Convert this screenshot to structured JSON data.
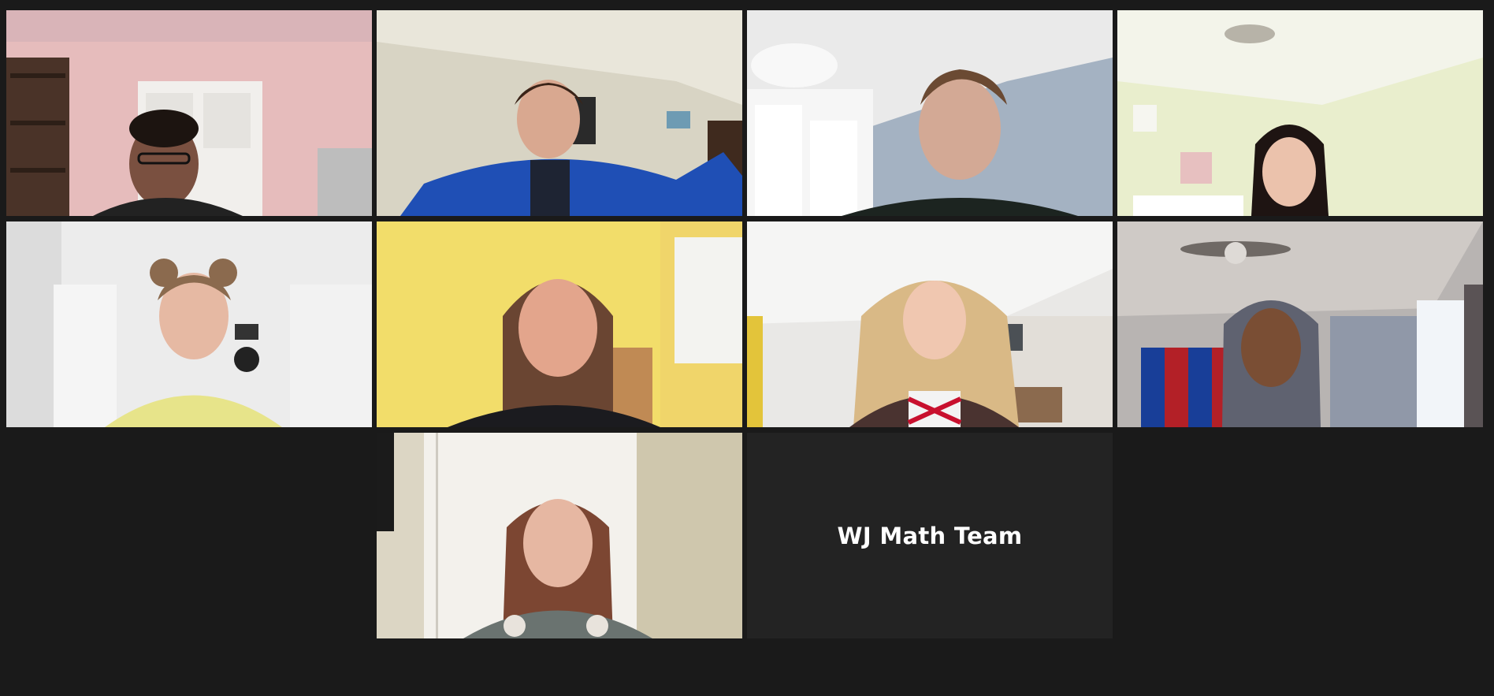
{
  "meeting": {
    "team_name": "WJ Math Team",
    "active_tile_color": "#d7ea5a",
    "background_color": "#1a1a1a"
  },
  "participants": [
    {
      "id": "p1",
      "type": "video",
      "active": false
    },
    {
      "id": "p2",
      "type": "video",
      "active": true
    },
    {
      "id": "p3",
      "type": "video",
      "active": false
    },
    {
      "id": "p4",
      "type": "video",
      "active": false
    },
    {
      "id": "p5",
      "type": "video",
      "active": false
    },
    {
      "id": "p6",
      "type": "video",
      "active": false
    },
    {
      "id": "p7",
      "type": "video",
      "active": false
    },
    {
      "id": "p8",
      "type": "video",
      "active": false
    },
    {
      "id": "p9",
      "type": "video",
      "active": false
    },
    {
      "id": "p10",
      "type": "name-only",
      "active": false
    }
  ]
}
